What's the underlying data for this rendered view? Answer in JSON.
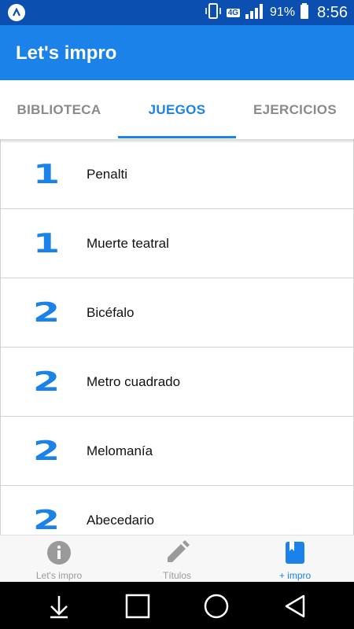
{
  "status_bar": {
    "network": "4G",
    "battery": "91%",
    "time": "8:56"
  },
  "app_bar": {
    "title": "Let's impro"
  },
  "tabs": [
    {
      "label": "BIBLIOTECA",
      "active": false
    },
    {
      "label": "JUEGOS",
      "active": true
    },
    {
      "label": "EJERCICIOS",
      "active": false
    }
  ],
  "games": [
    {
      "players": "1",
      "name": "Penalti"
    },
    {
      "players": "1",
      "name": "Muerte teatral"
    },
    {
      "players": "2",
      "name": "Bicéfalo"
    },
    {
      "players": "2",
      "name": "Metro cuadrado"
    },
    {
      "players": "2",
      "name": "Melomanía"
    },
    {
      "players": "2",
      "name": "Abecedario"
    }
  ],
  "bottom_nav": [
    {
      "label": "Let's impro",
      "icon": "info-icon",
      "active": false
    },
    {
      "label": "Títulos",
      "icon": "pencil-icon",
      "active": false
    },
    {
      "label": "+ impro",
      "icon": "book-icon",
      "active": true
    }
  ],
  "colors": {
    "primary": "#1a82e8",
    "status_bar": "#0b4fb0",
    "inactive": "#8a8a8a"
  }
}
